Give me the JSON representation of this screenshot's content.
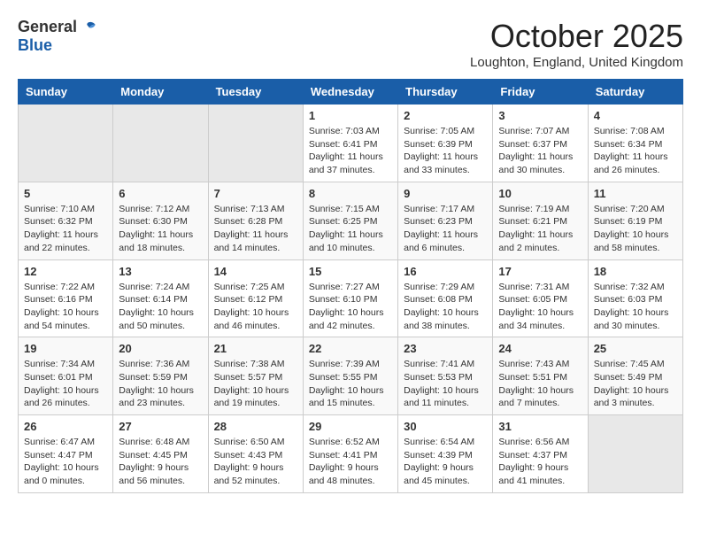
{
  "header": {
    "logo_general": "General",
    "logo_blue": "Blue",
    "month_title": "October 2025",
    "location": "Loughton, England, United Kingdom"
  },
  "weekdays": [
    "Sunday",
    "Monday",
    "Tuesday",
    "Wednesday",
    "Thursday",
    "Friday",
    "Saturday"
  ],
  "weeks": [
    [
      {
        "day": "",
        "info": ""
      },
      {
        "day": "",
        "info": ""
      },
      {
        "day": "",
        "info": ""
      },
      {
        "day": "1",
        "info": "Sunrise: 7:03 AM\nSunset: 6:41 PM\nDaylight: 11 hours\nand 37 minutes."
      },
      {
        "day": "2",
        "info": "Sunrise: 7:05 AM\nSunset: 6:39 PM\nDaylight: 11 hours\nand 33 minutes."
      },
      {
        "day": "3",
        "info": "Sunrise: 7:07 AM\nSunset: 6:37 PM\nDaylight: 11 hours\nand 30 minutes."
      },
      {
        "day": "4",
        "info": "Sunrise: 7:08 AM\nSunset: 6:34 PM\nDaylight: 11 hours\nand 26 minutes."
      }
    ],
    [
      {
        "day": "5",
        "info": "Sunrise: 7:10 AM\nSunset: 6:32 PM\nDaylight: 11 hours\nand 22 minutes."
      },
      {
        "day": "6",
        "info": "Sunrise: 7:12 AM\nSunset: 6:30 PM\nDaylight: 11 hours\nand 18 minutes."
      },
      {
        "day": "7",
        "info": "Sunrise: 7:13 AM\nSunset: 6:28 PM\nDaylight: 11 hours\nand 14 minutes."
      },
      {
        "day": "8",
        "info": "Sunrise: 7:15 AM\nSunset: 6:25 PM\nDaylight: 11 hours\nand 10 minutes."
      },
      {
        "day": "9",
        "info": "Sunrise: 7:17 AM\nSunset: 6:23 PM\nDaylight: 11 hours\nand 6 minutes."
      },
      {
        "day": "10",
        "info": "Sunrise: 7:19 AM\nSunset: 6:21 PM\nDaylight: 11 hours\nand 2 minutes."
      },
      {
        "day": "11",
        "info": "Sunrise: 7:20 AM\nSunset: 6:19 PM\nDaylight: 10 hours\nand 58 minutes."
      }
    ],
    [
      {
        "day": "12",
        "info": "Sunrise: 7:22 AM\nSunset: 6:16 PM\nDaylight: 10 hours\nand 54 minutes."
      },
      {
        "day": "13",
        "info": "Sunrise: 7:24 AM\nSunset: 6:14 PM\nDaylight: 10 hours\nand 50 minutes."
      },
      {
        "day": "14",
        "info": "Sunrise: 7:25 AM\nSunset: 6:12 PM\nDaylight: 10 hours\nand 46 minutes."
      },
      {
        "day": "15",
        "info": "Sunrise: 7:27 AM\nSunset: 6:10 PM\nDaylight: 10 hours\nand 42 minutes."
      },
      {
        "day": "16",
        "info": "Sunrise: 7:29 AM\nSunset: 6:08 PM\nDaylight: 10 hours\nand 38 minutes."
      },
      {
        "day": "17",
        "info": "Sunrise: 7:31 AM\nSunset: 6:05 PM\nDaylight: 10 hours\nand 34 minutes."
      },
      {
        "day": "18",
        "info": "Sunrise: 7:32 AM\nSunset: 6:03 PM\nDaylight: 10 hours\nand 30 minutes."
      }
    ],
    [
      {
        "day": "19",
        "info": "Sunrise: 7:34 AM\nSunset: 6:01 PM\nDaylight: 10 hours\nand 26 minutes."
      },
      {
        "day": "20",
        "info": "Sunrise: 7:36 AM\nSunset: 5:59 PM\nDaylight: 10 hours\nand 23 minutes."
      },
      {
        "day": "21",
        "info": "Sunrise: 7:38 AM\nSunset: 5:57 PM\nDaylight: 10 hours\nand 19 minutes."
      },
      {
        "day": "22",
        "info": "Sunrise: 7:39 AM\nSunset: 5:55 PM\nDaylight: 10 hours\nand 15 minutes."
      },
      {
        "day": "23",
        "info": "Sunrise: 7:41 AM\nSunset: 5:53 PM\nDaylight: 10 hours\nand 11 minutes."
      },
      {
        "day": "24",
        "info": "Sunrise: 7:43 AM\nSunset: 5:51 PM\nDaylight: 10 hours\nand 7 minutes."
      },
      {
        "day": "25",
        "info": "Sunrise: 7:45 AM\nSunset: 5:49 PM\nDaylight: 10 hours\nand 3 minutes."
      }
    ],
    [
      {
        "day": "26",
        "info": "Sunrise: 6:47 AM\nSunset: 4:47 PM\nDaylight: 10 hours\nand 0 minutes."
      },
      {
        "day": "27",
        "info": "Sunrise: 6:48 AM\nSunset: 4:45 PM\nDaylight: 9 hours\nand 56 minutes."
      },
      {
        "day": "28",
        "info": "Sunrise: 6:50 AM\nSunset: 4:43 PM\nDaylight: 9 hours\nand 52 minutes."
      },
      {
        "day": "29",
        "info": "Sunrise: 6:52 AM\nSunset: 4:41 PM\nDaylight: 9 hours\nand 48 minutes."
      },
      {
        "day": "30",
        "info": "Sunrise: 6:54 AM\nSunset: 4:39 PM\nDaylight: 9 hours\nand 45 minutes."
      },
      {
        "day": "31",
        "info": "Sunrise: 6:56 AM\nSunset: 4:37 PM\nDaylight: 9 hours\nand 41 minutes."
      },
      {
        "day": "",
        "info": ""
      }
    ]
  ]
}
